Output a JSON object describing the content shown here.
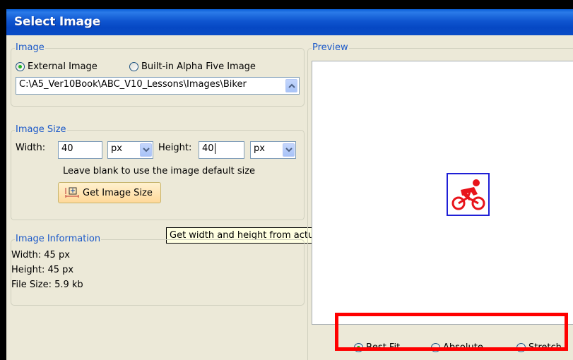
{
  "window": {
    "title": "Select Image"
  },
  "image_group": {
    "label": "Image",
    "radio_external": "External Image",
    "radio_builtin": "Built-in Alpha Five Image",
    "path_value": "C:\\A5_Ver10Book\\ABC_V10_Lessons\\Images\\Biker"
  },
  "size_group": {
    "label": "Image Size",
    "width_label": "Width:",
    "width_value": "40",
    "width_unit": "px",
    "height_label": "Height:",
    "height_value": "40",
    "height_unit": "px",
    "hint": "Leave blank to use the image default size",
    "get_size_button": "Get Image Size"
  },
  "tooltip": "Get width and height from actual image size",
  "info_group": {
    "label": "Image Information",
    "width": "Width:  45 px",
    "height": "Height:  45 px",
    "file_size": "File Size:  5.9 kb"
  },
  "preview": {
    "label": "Preview",
    "fit_best": "Best Fit",
    "fit_absolute": "Absolute",
    "fit_stretch": "Stretch"
  },
  "colors": {
    "titlebar": "#0a4cc6",
    "group_label": "#1b59c9",
    "highlight": "#ff0000",
    "bike_icon": "#e8141b"
  }
}
